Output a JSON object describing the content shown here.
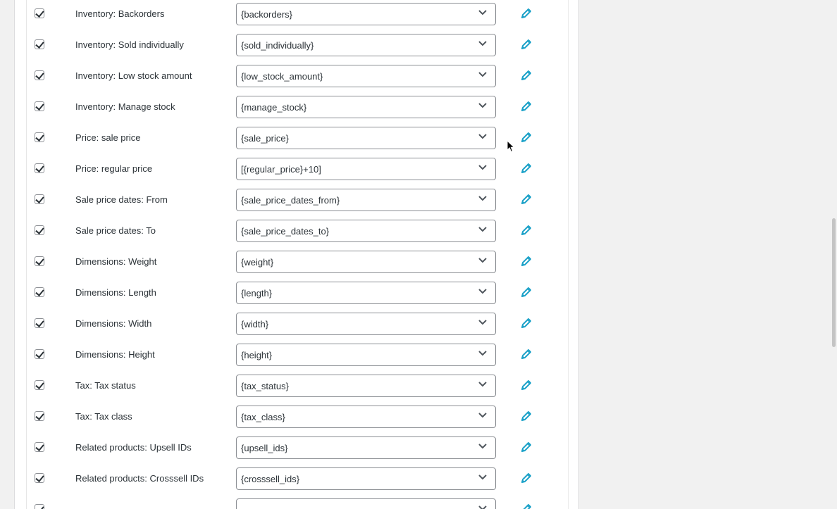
{
  "rows": [
    {
      "label": "Inventory: Backorders",
      "value": "{backorders}"
    },
    {
      "label": "Inventory: Sold individually",
      "value": "{sold_individually}"
    },
    {
      "label": "Inventory: Low stock amount",
      "value": "{low_stock_amount}"
    },
    {
      "label": "Inventory: Manage stock",
      "value": "{manage_stock}"
    },
    {
      "label": "Price: sale price",
      "value": "{sale_price}"
    },
    {
      "label": "Price: regular price",
      "value": "[{regular_price}+10]"
    },
    {
      "label": "Sale price dates: From",
      "value": "{sale_price_dates_from}"
    },
    {
      "label": "Sale price dates: To",
      "value": "{sale_price_dates_to}"
    },
    {
      "label": "Dimensions: Weight",
      "value": "{weight}"
    },
    {
      "label": "Dimensions: Length",
      "value": "{length}"
    },
    {
      "label": "Dimensions: Width",
      "value": "{width}"
    },
    {
      "label": "Dimensions: Height",
      "value": "{height}"
    },
    {
      "label": "Tax: Tax status",
      "value": "{tax_status}"
    },
    {
      "label": "Tax: Tax class",
      "value": "{tax_class}"
    },
    {
      "label": "Related products: Upsell IDs",
      "value": "{upsell_ids}"
    },
    {
      "label": "Related products: Crosssell IDs",
      "value": "{crosssell_ids}"
    }
  ],
  "icons": {
    "checkbox": "checkmark-icon",
    "select": "chevron-down-icon",
    "edit": "pencil-icon",
    "cursor": "mouse-pointer-icon"
  },
  "colors": {
    "accent": "#2271b1",
    "edit_icon": "#1fa3c9",
    "border": "#8c8f94"
  }
}
